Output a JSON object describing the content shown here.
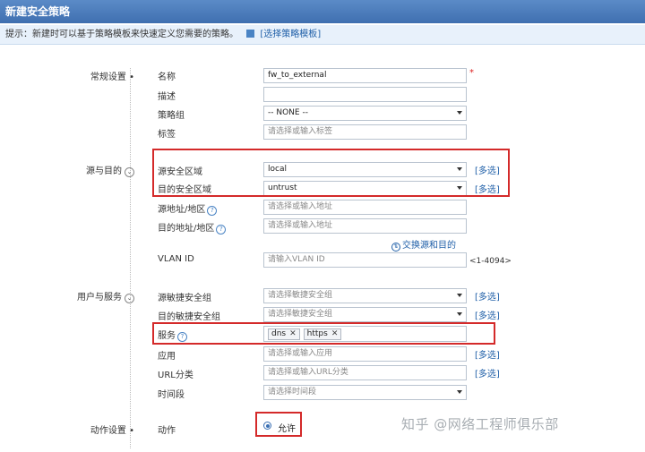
{
  "dialog": {
    "title": "新建安全策略"
  },
  "hint": {
    "text": "提示：新建时可以基于策略模板来快速定义您需要的策略。",
    "link": "[选择策略模板]"
  },
  "sections": {
    "general": "常规设置",
    "source_dest": "源与目的",
    "user_service": "用户与服务",
    "action": "动作设置"
  },
  "labels": {
    "name": "名称",
    "desc": "描述",
    "policy_group": "策略组",
    "tag": "标签",
    "src_zone": "源安全区域",
    "dst_zone": "目的安全区域",
    "src_addr": "源地址/地区",
    "dst_addr": "目的地址/地区",
    "vlan": "VLAN ID",
    "src_sec_group": "源敏捷安全组",
    "dst_sec_group": "目的敏捷安全组",
    "service": "服务",
    "app": "应用",
    "url": "URL分类",
    "time": "时间段",
    "action": "动作"
  },
  "values": {
    "name": "fw_to_external",
    "desc": "",
    "policy_group": "-- NONE --",
    "src_zone": "local",
    "dst_zone": "untrust",
    "services": [
      "dns",
      "https"
    ],
    "action": "允许"
  },
  "placeholders": {
    "tag": "请选择或输入标签",
    "src_addr": "请选择或输入地址",
    "dst_addr": "请选择或输入地址",
    "vlan": "请输入VLAN ID",
    "src_sec_group": "请选择敏捷安全组",
    "dst_sec_group": "请选择敏捷安全组",
    "app": "请选择或输入应用",
    "url": "请选择或输入URL分类",
    "time": "请选择时间段"
  },
  "links": {
    "multi": "[多选]",
    "swap": "交换源和目的"
  },
  "vlan_range": "<1-4094>",
  "required_mark": "*",
  "watermark": "知乎 @网络工程师俱乐部",
  "icons": [
    "section-toggle-icon",
    "help-icon",
    "swap-icon",
    "template-icon",
    "remove-tag-icon"
  ]
}
